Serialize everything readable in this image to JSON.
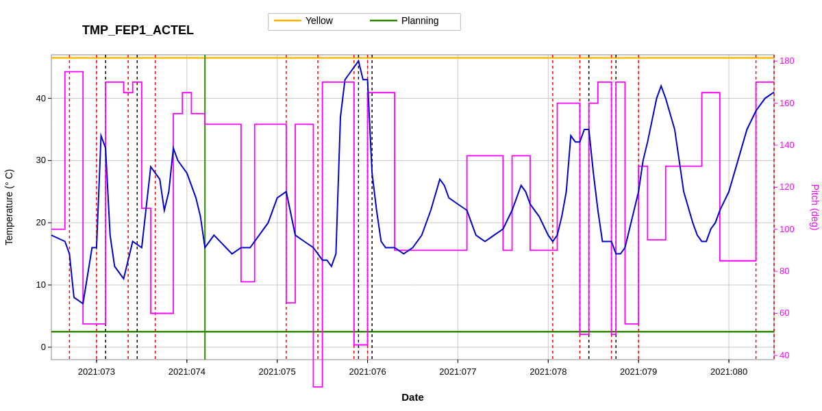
{
  "title": "TMP_FEP1_ACTEL",
  "legend": {
    "yellow_label": "Yellow",
    "planning_label": "Planning"
  },
  "axes": {
    "x_label": "Date",
    "y_left_label": "Temperature (° C)",
    "y_right_label": "Pitch (deg)",
    "x_ticks": [
      "2021:073",
      "2021:074",
      "2021:075",
      "2021:076",
      "2021:077",
      "2021:078",
      "2021:079",
      "2021:080"
    ],
    "y_left_ticks": [
      0,
      10,
      20,
      30,
      40
    ],
    "y_right_ticks": [
      40,
      60,
      80,
      100,
      120,
      140,
      160,
      180
    ],
    "x_min": 72.5,
    "x_max": 80.5,
    "y_left_min": -2,
    "y_left_max": 47,
    "y_right_min": 38,
    "y_right_max": 183
  },
  "colors": {
    "yellow_line": "#FFB700",
    "planning_line": "#2E8B00",
    "blue_line": "#0000CC",
    "magenta_line": "#FF00FF",
    "red_dotted": "#FF0000",
    "black_dotted": "#000000",
    "grid": "#BBBBBB",
    "background": "#FFFFFF"
  }
}
